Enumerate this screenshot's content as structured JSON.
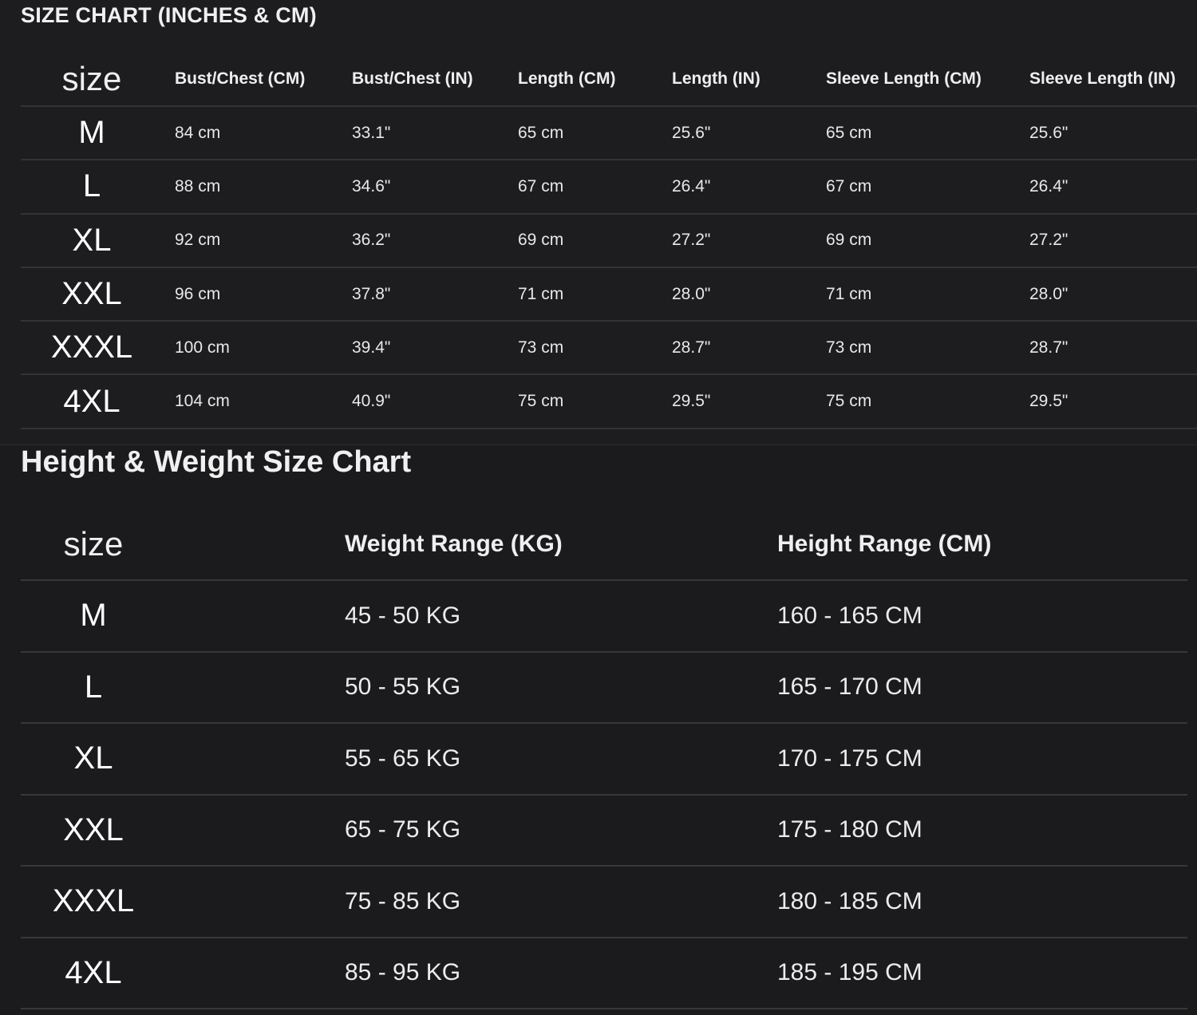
{
  "size_chart": {
    "title": "SIZE CHART (INCHES & CM)",
    "columns": [
      "size",
      "Bust/Chest (CM)",
      "Bust/Chest (IN)",
      "Length (CM)",
      "Length (IN)",
      "Sleeve Length (CM)",
      "Sleeve Length (IN)"
    ],
    "rows": [
      [
        "M",
        "84 cm",
        "33.1\"",
        "65 cm",
        "25.6\"",
        "65 cm",
        "25.6\""
      ],
      [
        "L",
        "88 cm",
        "34.6\"",
        "67 cm",
        "26.4\"",
        "67 cm",
        "26.4\""
      ],
      [
        "XL",
        "92 cm",
        "36.2\"",
        "69 cm",
        "27.2\"",
        "69 cm",
        "27.2\""
      ],
      [
        "XXL",
        "96 cm",
        "37.8\"",
        "71 cm",
        "28.0\"",
        "71 cm",
        "28.0\""
      ],
      [
        "XXXL",
        "100 cm",
        "39.4\"",
        "73 cm",
        "28.7\"",
        "73 cm",
        "28.7\""
      ],
      [
        "4XL",
        "104 cm",
        "40.9\"",
        "75 cm",
        "29.5\"",
        "75 cm",
        "29.5\""
      ]
    ]
  },
  "height_weight_chart": {
    "title": "Height & Weight Size Chart",
    "columns": [
      "size",
      "Weight Range (KG)",
      "Height Range (CM)"
    ],
    "rows": [
      [
        "M",
        "45 - 50 KG",
        "160 - 165 CM"
      ],
      [
        "L",
        "50 - 55 KG",
        "165 - 170 CM"
      ],
      [
        "XL",
        "55 - 65 KG",
        "170 - 175 CM"
      ],
      [
        "XXL",
        "65 - 75 KG",
        "175 - 180 CM"
      ],
      [
        "XXXL",
        "75 - 85 KG",
        "180 - 185 CM"
      ],
      [
        "4XL",
        "85 - 95 KG",
        "185 - 195 CM"
      ]
    ]
  },
  "colors": {
    "background": "#1d1d1f",
    "text": "#f2f2f2",
    "rule": "#333336"
  }
}
